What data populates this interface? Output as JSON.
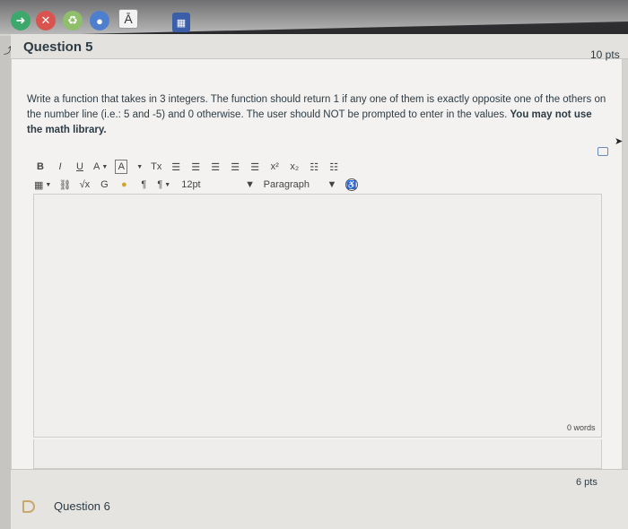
{
  "dock": {
    "letter_icon": "Ā",
    "calculator_icon": "▦"
  },
  "question5": {
    "title": "Question 5",
    "points": "10 pts",
    "prompt_text": "Write a function that takes in 3 integers. The function should return 1 if any one of them is exactly opposite one of the others on the number line (i.e.: 5 and -5) and 0 otherwise. The user should NOT be prompted to enter in the values.",
    "prompt_bold": "You may not use the math library."
  },
  "toolbar": {
    "row1": {
      "bold": "B",
      "italic": "I",
      "underline": "U",
      "text_color": "A",
      "bg_color": "A",
      "clear_format": "Tx",
      "superscript": "x²",
      "subscript": "x₂"
    },
    "row2": {
      "font_size": "12pt",
      "paragraph": "Paragraph"
    }
  },
  "editor": {
    "word_count": "0 words"
  },
  "question6": {
    "title": "Question 6",
    "points": "6 pts"
  }
}
